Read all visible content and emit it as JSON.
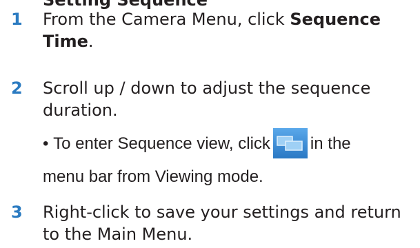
{
  "heading_fragment": "Setting Sequence",
  "steps": [
    {
      "number": "1",
      "text_before": "From the Camera Menu, click ",
      "text_bold": "Sequence Time",
      "text_after": "."
    },
    {
      "number": "2",
      "text": "Scroll up / down to adjust the sequence duration."
    },
    {
      "number": "3",
      "text": "Right-click to save your settings and return to the Main Menu."
    }
  ],
  "note": {
    "bullet": "•",
    "text_before_icon": "To enter Sequence view, click",
    "icon": "sequence-view-icon",
    "text_after_icon_line1": "in the",
    "text_line2": "menu bar from Viewing mode."
  },
  "colors": {
    "step_number": "#2b7bc1",
    "body_text": "#231f20",
    "icon_bg": "#3b8fd9",
    "icon_window": "#9fd0f5"
  }
}
